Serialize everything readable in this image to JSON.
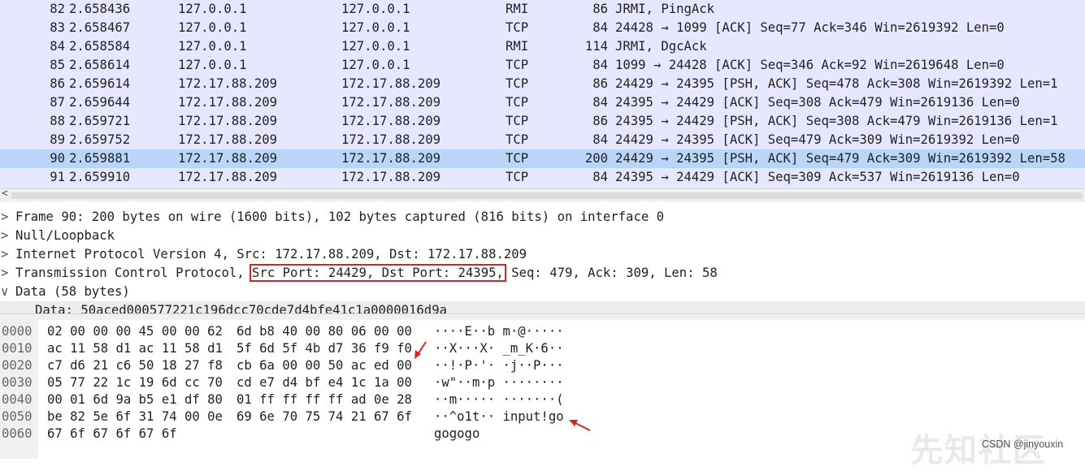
{
  "packets": [
    {
      "no": "82",
      "time": "2.658436",
      "src": "127.0.0.1",
      "dst": "127.0.0.1",
      "proto": "RMI",
      "len": "86",
      "info": "JRMI, PingAck"
    },
    {
      "no": "83",
      "time": "2.658467",
      "src": "127.0.0.1",
      "dst": "127.0.0.1",
      "proto": "TCP",
      "len": "84",
      "info": "24428 → 1099 [ACK] Seq=77 Ack=346 Win=2619392 Len=0"
    },
    {
      "no": "84",
      "time": "2.658584",
      "src": "127.0.0.1",
      "dst": "127.0.0.1",
      "proto": "RMI",
      "len": "114",
      "info": "JRMI, DgcAck"
    },
    {
      "no": "85",
      "time": "2.658614",
      "src": "127.0.0.1",
      "dst": "127.0.0.1",
      "proto": "TCP",
      "len": "84",
      "info": "1099 → 24428 [ACK] Seq=346 Ack=92 Win=2619648 Len=0"
    },
    {
      "no": "86",
      "time": "2.659614",
      "src": "172.17.88.209",
      "dst": "172.17.88.209",
      "proto": "TCP",
      "len": "86",
      "info": "24429 → 24395 [PSH, ACK] Seq=478 Ack=308 Win=2619392 Len=1"
    },
    {
      "no": "87",
      "time": "2.659644",
      "src": "172.17.88.209",
      "dst": "172.17.88.209",
      "proto": "TCP",
      "len": "84",
      "info": "24395 → 24429 [ACK] Seq=308 Ack=479 Win=2619136 Len=0"
    },
    {
      "no": "88",
      "time": "2.659721",
      "src": "172.17.88.209",
      "dst": "172.17.88.209",
      "proto": "TCP",
      "len": "86",
      "info": "24395 → 24429 [PSH, ACK] Seq=308 Ack=479 Win=2619136 Len=1"
    },
    {
      "no": "89",
      "time": "2.659752",
      "src": "172.17.88.209",
      "dst": "172.17.88.209",
      "proto": "TCP",
      "len": "84",
      "info": "24429 → 24395 [ACK] Seq=479 Ack=309 Win=2619392 Len=0"
    },
    {
      "no": "90",
      "time": "2.659881",
      "src": "172.17.88.209",
      "dst": "172.17.88.209",
      "proto": "TCP",
      "len": "200",
      "info": "24429 → 24395 [PSH, ACK] Seq=479 Ack=309 Win=2619392 Len=58"
    },
    {
      "no": "91",
      "time": "2.659910",
      "src": "172.17.88.209",
      "dst": "172.17.88.209",
      "proto": "TCP",
      "len": "84",
      "info": "24395 → 24429 [ACK] Seq=309 Ack=537 Win=2619136 Len=0"
    }
  ],
  "selected_packet": "90",
  "details": {
    "frame": "Frame 90: 200 bytes on wire (1600 bits), 102 bytes captured (816 bits) on interface 0",
    "null": "Null/Loopback",
    "ip": "Internet Protocol Version 4, Src: 172.17.88.209, Dst: 172.17.88.209",
    "tcp_prefix": "Transmission Control Protocol, ",
    "tcp_ports": "Src Port: 24429, Dst Port: 24395,",
    "tcp_suffix": " Seq: 479, Ack: 309, Len: 58",
    "data": "Data (58 bytes)",
    "data_child": "Data: 50aced000577221c196dcc70cde7d4bfe41c1a0000016d9a",
    "collapsed_glyph": ">",
    "expanded_glyph": "∨"
  },
  "bytes": [
    {
      "off": "0000",
      "h1": "02 00 00 00 45 00 00 62",
      "h2": "6d b8 40 00 80 06 00 00",
      "asc": "····E··b m·@·····"
    },
    {
      "off": "0010",
      "h1": "ac 11 58 d1 ac 11 58 d1",
      "h2": "5f 6d 5f 4b d7 36 f9 f0",
      "asc": "··X···X· _m_K·6··"
    },
    {
      "off": "0020",
      "h1": "c7 d6 21 c6 50 18 27 f8",
      "h2": "cb 6a 00 00 50 ac ed 00",
      "asc": "··!·P·'· ·j··P···"
    },
    {
      "off": "0030",
      "h1": "05 77 22 1c 19 6d cc 70",
      "h2": "cd e7 d4 bf e4 1c 1a 00",
      "asc": "·w\"··m·p ········"
    },
    {
      "off": "0040",
      "h1": "00 01 6d 9a b5 e1 df 80",
      "h2": "01 ff ff ff ff ad 0e 28",
      "asc": "··m····· ·······("
    },
    {
      "off": "0050",
      "h1": "be 82 5e 6f 31 74 00 0e",
      "h2": "69 6e 70 75 74 21 67 6f",
      "asc": "··^o1t·· input!go"
    },
    {
      "off": "0060",
      "h1": "67 6f 67 6f 67 6f",
      "h2": "",
      "asc": "gogogo"
    }
  ],
  "hscroll_arrow": "<",
  "watermark": "先知社区",
  "credit": "CSDN @jinyouxin",
  "colors": {
    "list_bg": "#e7e6ff",
    "selected_bg": "#b9d6f8",
    "annotation": "#e02020"
  }
}
